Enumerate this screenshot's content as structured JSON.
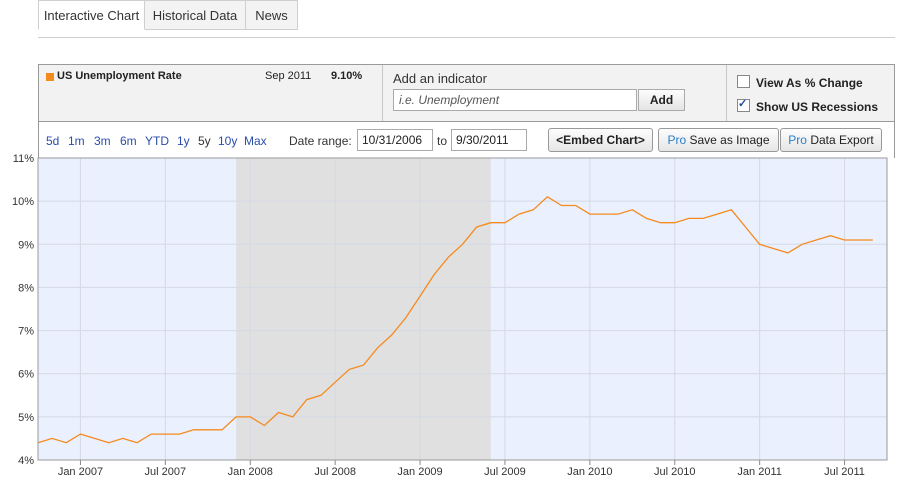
{
  "tabs": [
    {
      "label": "Interactive Chart",
      "active": true
    },
    {
      "label": "Historical Data",
      "active": false
    },
    {
      "label": "News",
      "active": false
    }
  ],
  "indicator": {
    "series_name": "US Unemployment Rate",
    "latest_date": "Sep 2011",
    "latest_value": "9.10%",
    "swatch_color": "#f58a1f"
  },
  "add_indicator": {
    "label": "Add an indicator",
    "placeholder": "i.e. Unemployment",
    "button": "Add"
  },
  "options": {
    "view_pct_change": {
      "label": "View As % Change",
      "checked": false
    },
    "show_recessions": {
      "label": "Show US Recessions",
      "checked": true
    }
  },
  "ranges": [
    "5d",
    "1m",
    "3m",
    "6m",
    "YTD",
    "1y",
    "5y",
    "10y",
    "Max"
  ],
  "date_range": {
    "label": "Date range:",
    "from": "10/31/2006",
    "to_label": "to",
    "to": "9/30/2011"
  },
  "buttons": {
    "embed": "<Embed Chart>",
    "save_pro": "Pro",
    "save": "Save as Image",
    "export_pro": "Pro",
    "export": "Data Export"
  },
  "chart_data": {
    "type": "line",
    "title": "",
    "xlabel": "",
    "ylabel": "",
    "ylim": [
      4,
      11
    ],
    "yticks": [
      "4%",
      "5%",
      "6%",
      "7%",
      "8%",
      "9%",
      "10%",
      "11%"
    ],
    "x_tick_labels": [
      "Jan 2007",
      "Jul 2007",
      "Jan 2008",
      "Jul 2008",
      "Jan 2009",
      "Jul 2009",
      "Jan 2010",
      "Jul 2010",
      "Jan 2011",
      "Jul 2011"
    ],
    "x_tick_dates": [
      "2007-01",
      "2007-07",
      "2008-01",
      "2008-07",
      "2009-01",
      "2009-07",
      "2010-01",
      "2010-07",
      "2011-01",
      "2011-07"
    ],
    "x_range": [
      "2006-10",
      "2011-10"
    ],
    "recession": {
      "start": "2007-12",
      "end": "2009-06",
      "color": "#e0e0e0"
    },
    "background_color": "#eaf0fd",
    "line_color": "#f58a1f",
    "grid": true,
    "series": [
      {
        "name": "US Unemployment Rate",
        "x": [
          "2006-10",
          "2006-11",
          "2006-12",
          "2007-01",
          "2007-02",
          "2007-03",
          "2007-04",
          "2007-05",
          "2007-06",
          "2007-07",
          "2007-08",
          "2007-09",
          "2007-10",
          "2007-11",
          "2007-12",
          "2008-01",
          "2008-02",
          "2008-03",
          "2008-04",
          "2008-05",
          "2008-06",
          "2008-07",
          "2008-08",
          "2008-09",
          "2008-10",
          "2008-11",
          "2008-12",
          "2009-01",
          "2009-02",
          "2009-03",
          "2009-04",
          "2009-05",
          "2009-06",
          "2009-07",
          "2009-08",
          "2009-09",
          "2009-10",
          "2009-11",
          "2009-12",
          "2010-01",
          "2010-02",
          "2010-03",
          "2010-04",
          "2010-05",
          "2010-06",
          "2010-07",
          "2010-08",
          "2010-09",
          "2010-10",
          "2010-11",
          "2010-12",
          "2011-01",
          "2011-02",
          "2011-03",
          "2011-04",
          "2011-05",
          "2011-06",
          "2011-07",
          "2011-08",
          "2011-09"
        ],
        "values": [
          4.4,
          4.5,
          4.4,
          4.6,
          4.5,
          4.4,
          4.5,
          4.4,
          4.6,
          4.6,
          4.6,
          4.7,
          4.7,
          4.7,
          5.0,
          5.0,
          4.8,
          5.1,
          5.0,
          5.4,
          5.5,
          5.8,
          6.1,
          6.2,
          6.6,
          6.9,
          7.3,
          7.8,
          8.3,
          8.7,
          9.0,
          9.4,
          9.5,
          9.5,
          9.7,
          9.8,
          10.1,
          9.9,
          9.9,
          9.7,
          9.7,
          9.7,
          9.8,
          9.6,
          9.5,
          9.5,
          9.6,
          9.6,
          9.7,
          9.8,
          9.4,
          9.0,
          8.9,
          8.8,
          9.0,
          9.1,
          9.2,
          9.1,
          9.1,
          9.1
        ]
      }
    ]
  }
}
